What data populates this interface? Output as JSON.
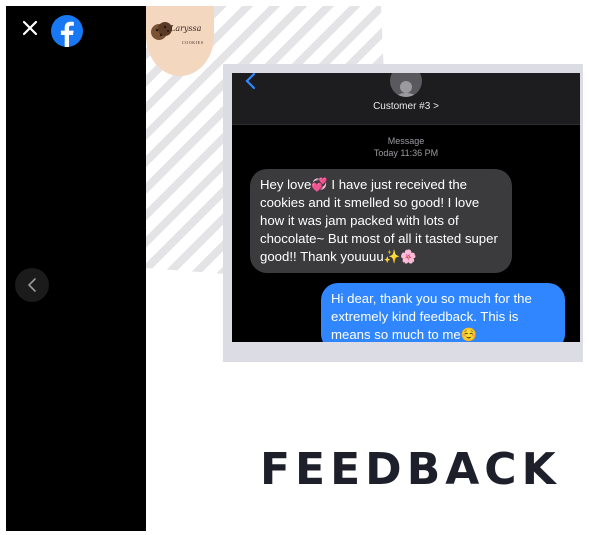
{
  "viewer": {
    "close_icon": "close-icon",
    "facebook_icon": "facebook-logo-icon",
    "prev_icon": "chevron-left-icon"
  },
  "post_image": {
    "brand": {
      "name": "Laryssa",
      "subtitle": "COOKIES"
    },
    "chat": {
      "contact_name": "Customer #3 >",
      "meta_label": "Message",
      "meta_time": "Today 11:36 PM",
      "incoming_message": "Hey love💞 I have just received the cookies and it smelled so good! I love how it was jam packed with lots of chocolate~ But most of all it tasted super good!! Thank youuuu✨🌸",
      "outgoing_message": "Hi dear, thank you so much for the extremely kind feedback. This is means so much to me☺️"
    },
    "caption": "FEEDBACK"
  },
  "colors": {
    "incoming_bubble": "#3b3b3d",
    "outgoing_bubble": "#2f86ff",
    "caption_text": "#1d1f2a",
    "brand_circle": "#f3d7bf"
  }
}
